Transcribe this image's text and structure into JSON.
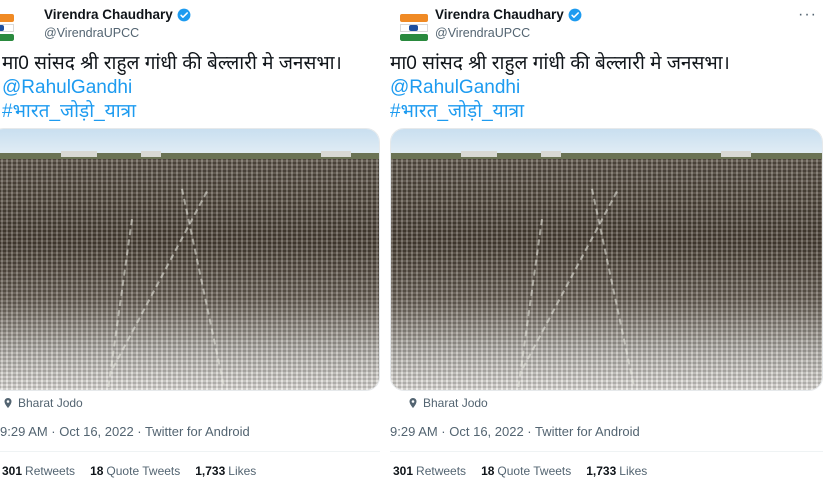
{
  "tweet": {
    "author_name": "Virendra Chaudhary",
    "handle": "@VirendraUPCC",
    "text_line1": "मा0 सांसद श्री राहुल गांधी की बेल्लारी मे जनसभा।",
    "mention": "@RahulGandhi",
    "hashtag": "#भारत_जोड़ो_यात्रा",
    "location": "Bharat Jodo",
    "timestamp": "9:29 AM · Oct 16, 2022 · Twitter for Android",
    "more_label": "···",
    "stats": {
      "retweets_count": "301",
      "retweets_label": "Retweets",
      "quote_count": "18",
      "quote_label": "Quote Tweets",
      "likes_count": "1,733",
      "likes_label": "Likes"
    }
  },
  "icons": {
    "verified": "verified-badge-icon",
    "location": "location-pin-icon",
    "more": "more-options-icon"
  },
  "colors": {
    "link": "#1d9bf0",
    "secondary_text": "#536471",
    "primary_text": "#0f1419"
  }
}
